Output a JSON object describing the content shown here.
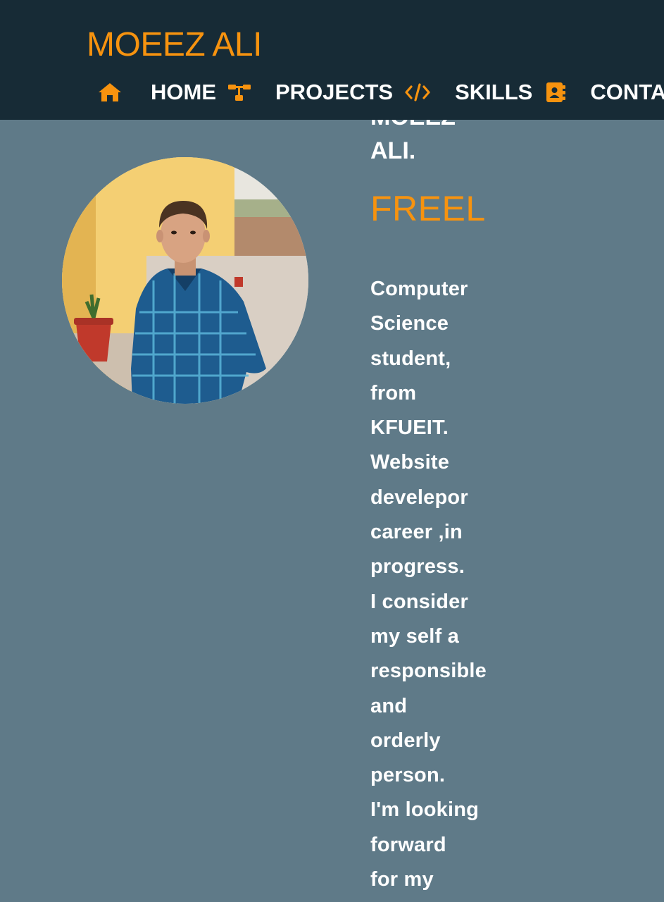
{
  "header": {
    "brand": "MOEEZ ALI",
    "nav": [
      {
        "label": "HOME",
        "icon": "home-icon"
      },
      {
        "label": "PROJECTS",
        "icon": "sitemap-icon"
      },
      {
        "label": "SKILLS",
        "icon": "code-icon"
      },
      {
        "label": "CONTACT",
        "icon": "contact-book-icon"
      }
    ]
  },
  "hero": {
    "name_lines": [
      "MOEEZ",
      "ALI."
    ],
    "role": "FREELANCER",
    "bio_lines": [
      "Computer",
      "Science",
      "student,",
      "from",
      "KFUEIT.",
      "Website",
      "develepor",
      "career ,in",
      "progress.",
      "I consider",
      "my self a",
      "responsible",
      "and",
      "orderly",
      "person.",
      "I'm looking",
      "forward",
      "for my"
    ]
  },
  "colors": {
    "accent": "#f7930f",
    "header_bg": "#172b36",
    "page_bg": "#5f7a88",
    "text": "#ffffff"
  }
}
